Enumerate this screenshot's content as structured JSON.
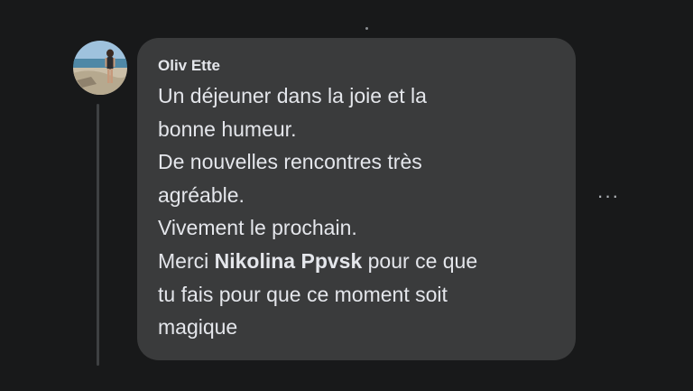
{
  "comment": {
    "author": "Oliv Ette",
    "lines": [
      "Un déjeuner dans la joie et la",
      "bonne humeur.",
      "De nouvelles rencontres très",
      "agréable.",
      "Vivement le prochain."
    ],
    "mention_prefix": "Merci ",
    "mention_name": "Nikolina Ppvsk",
    "mention_suffix": " pour ce que",
    "tail_lines": [
      "tu fais pour que ce moment soit",
      "magique"
    ]
  },
  "actions": {
    "more_label": "···"
  },
  "colors": {
    "background": "#18191a",
    "bubble": "#3a3b3c",
    "text": "#e4e6eb",
    "muted": "#b0b3b8"
  },
  "icons": {
    "more": "more-horizontal-icon",
    "avatar": "profile-photo-beach"
  }
}
